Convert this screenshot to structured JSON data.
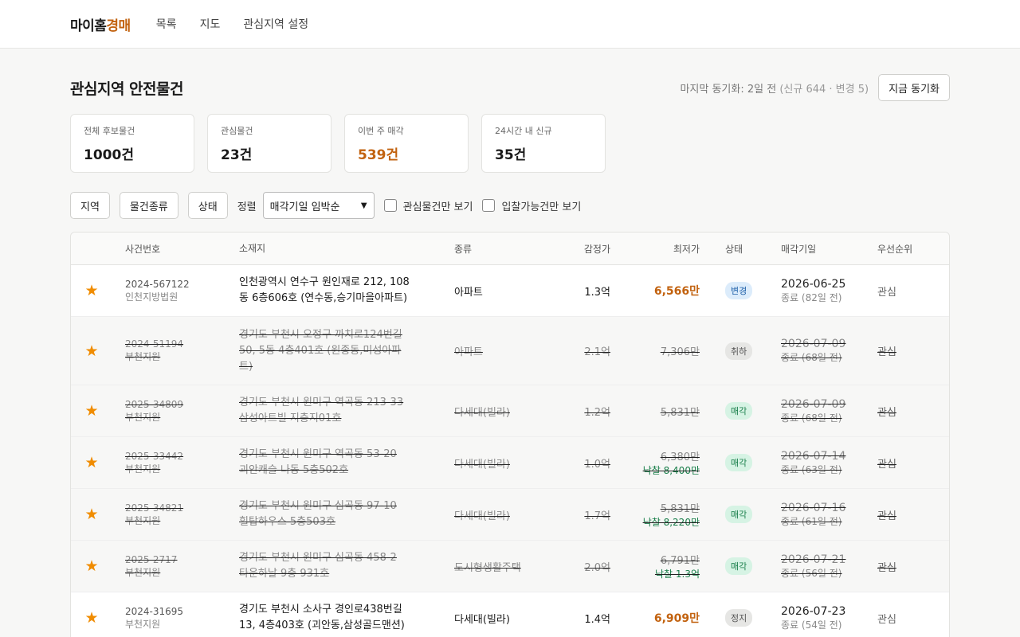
{
  "app": {
    "logo_part1": "마이홈",
    "logo_part2": "경매",
    "nav": [
      "목록",
      "지도",
      "관심지역 설정"
    ]
  },
  "colors": {
    "accent": "#c2620f",
    "star": "#f08c00",
    "sold": "#1a7f4b"
  },
  "page": {
    "title": "관심지역 안전물건",
    "sync_text": "마지막 동기화: 2일 전",
    "sync_detail": "(신규 644 · 변경 5)",
    "sync_button": "지금 동기화"
  },
  "stats": [
    {
      "label": "전체 후보물건",
      "value": "1000건"
    },
    {
      "label": "관심물건",
      "value": "23건"
    },
    {
      "label": "이번 주 매각",
      "value": "539건"
    },
    {
      "label": "24시간 내 신규",
      "value": "35건"
    }
  ],
  "filters": {
    "region": "지역",
    "type": "물건종류",
    "status": "상태",
    "sort_label": "정렬",
    "sort_value": "매각기일 임박순",
    "only_interest": "관심물건만 보기",
    "only_biddable": "입찰가능건만 보기"
  },
  "table": {
    "headers": [
      "사건번호",
      "소재지",
      "종류",
      "감정가",
      "최저가",
      "상태",
      "매각기일",
      "우선순위"
    ],
    "rows": [
      {
        "star": "★",
        "case": "2024-567122",
        "court": "인천지방법원",
        "loc1": "인천광역시 연수구 원인재로 212, 108",
        "loc2": "동 6층606호 (연수동,승기마을아파트)",
        "loc3": "",
        "type": "아파트",
        "appr": "1.3억",
        "min": "6,566만",
        "sold": "",
        "status": "변경",
        "date": "2026-06-25",
        "date_sub": "종료 (82일 전)",
        "pri": "관심"
      },
      {
        "star": "★",
        "case": "2024-51194",
        "court": "부천지원",
        "loc1": "경기도 부천시 오정구 까치로124번길",
        "loc2": "50, 5동 4층401호 (원종동,미성아파",
        "loc3": "트)",
        "type": "아파트",
        "appr": "2.1억",
        "min": "7,306만",
        "sold": "",
        "status": "취하",
        "date": "2026-07-09",
        "date_sub": "종료 (68일 전)",
        "pri": "관심"
      },
      {
        "star": "★",
        "case": "2025-34809",
        "court": "부천지원",
        "loc1": "경기도 부천시 원미구 역곡동 213-33",
        "loc2": "삼성아트빌 지층지01호",
        "loc3": "",
        "type": "다세대(빌라)",
        "appr": "1.2억",
        "min": "5,831만",
        "sold": "",
        "status": "매각",
        "date": "2026-07-09",
        "date_sub": "종료 (68일 전)",
        "pri": "관심"
      },
      {
        "star": "★",
        "case": "2025-33442",
        "court": "부천지원",
        "loc1": "경기도 부천시 원미구 역곡동 53-20",
        "loc2": "괴안캐슬 나동 5층502호",
        "loc3": "",
        "type": "다세대(빌라)",
        "appr": "1.0억",
        "min": "6,380만",
        "sold": "낙찰 8,400만",
        "status": "매각",
        "date": "2026-07-14",
        "date_sub": "종료 (63일 전)",
        "pri": "관심"
      },
      {
        "star": "★",
        "case": "2025-34821",
        "court": "부천지원",
        "loc1": "경기도 부천시 원미구 심곡동 97-10",
        "loc2": "힐탑하우스 5층503호",
        "loc3": "",
        "type": "다세대(빌라)",
        "appr": "1.7억",
        "min": "5,831만",
        "sold": "낙찰 8,220만",
        "status": "매각",
        "date": "2026-07-16",
        "date_sub": "종료 (61일 전)",
        "pri": "관심"
      },
      {
        "star": "★",
        "case": "2025-2717",
        "court": "부천지원",
        "loc1": "경기도 부천시 원미구 심곡동 458-2",
        "loc2": "타운하날 9층 931호",
        "loc3": "",
        "type": "도시형생활주택",
        "appr": "2.0억",
        "min": "6,791만",
        "sold": "낙찰 1.3억",
        "status": "매각",
        "date": "2026-07-21",
        "date_sub": "종료 (56일 전)",
        "pri": "관심"
      },
      {
        "star": "★",
        "case": "2024-31695",
        "court": "부천지원",
        "loc1": "경기도 부천시 소사구 경인로438번길",
        "loc2": "13, 4층403호 (괴안동,삼성골드맨션)",
        "loc3": "",
        "type": "다세대(빌라)",
        "appr": "1.4억",
        "min": "6,909만",
        "sold": "",
        "status": "정지",
        "date": "2026-07-23",
        "date_sub": "종료 (54일 전)",
        "pri": "관심"
      }
    ]
  }
}
